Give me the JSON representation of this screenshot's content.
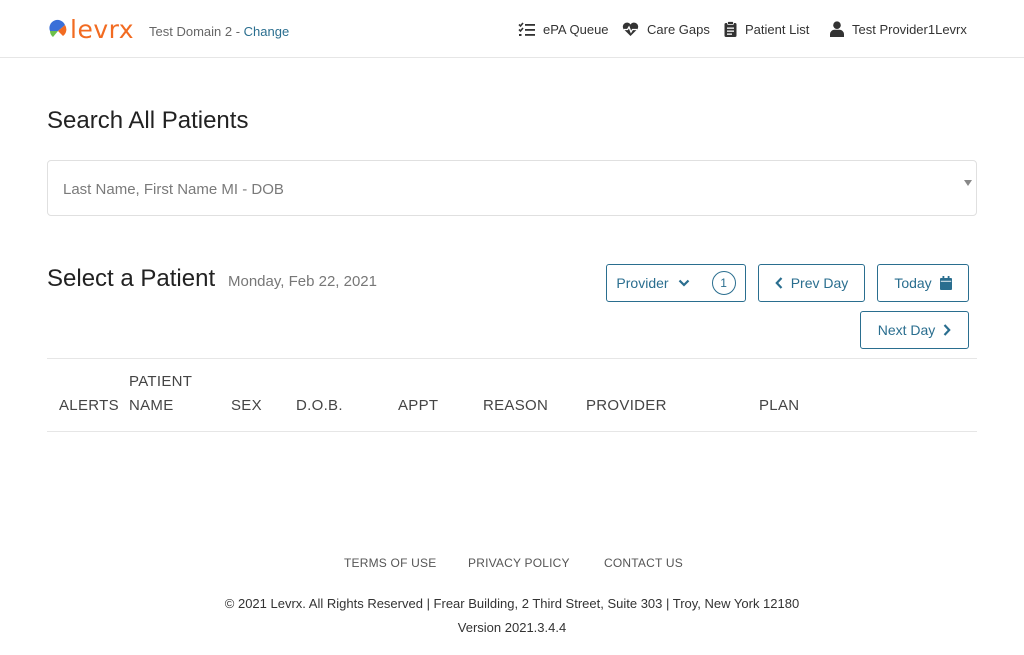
{
  "header": {
    "logo_text": "levrx",
    "domain_text": "Test Domain 2 - ",
    "domain_change_link": "Change",
    "nav": [
      {
        "label": "ePA Queue",
        "icon": "checklist-icon"
      },
      {
        "label": "Care Gaps",
        "icon": "heartbeat-icon"
      },
      {
        "label": "Patient List",
        "icon": "clipboard-icon"
      },
      {
        "label": "Test Provider1Levrx",
        "icon": "user-icon"
      }
    ]
  },
  "search": {
    "title": "Search All Patients",
    "placeholder": "Last Name, First Name MI - DOB"
  },
  "patients": {
    "title": "Select a Patient",
    "date": "Monday, Feb 22, 2021",
    "provider_button_label": "Provider",
    "provider_count": "1",
    "prev_day_label": "Prev Day",
    "today_label": "Today",
    "next_day_label": "Next Day",
    "columns": {
      "alerts": "ALERTS",
      "patient_line1": "PATIENT",
      "patient_line2": "NAME",
      "sex": "SEX",
      "dob": "D.O.B.",
      "appt": "APPT",
      "reason": "REASON",
      "provider": "PROVIDER",
      "plan": "PLAN"
    }
  },
  "footer": {
    "links": [
      "TERMS OF USE",
      "PRIVACY POLICY",
      "CONTACT US"
    ],
    "copyright": "© 2021 Levrx. All Rights Reserved | Frear Building, 2 Third Street, Suite 303 | Troy, New York 12180",
    "version": "Version 2021.3.4.4"
  },
  "colors": {
    "brand_orange": "#f26b21",
    "accent_blue": "#2a6e8f",
    "logo_green": "#6cc04a",
    "logo_blue": "#3a6fd8"
  }
}
